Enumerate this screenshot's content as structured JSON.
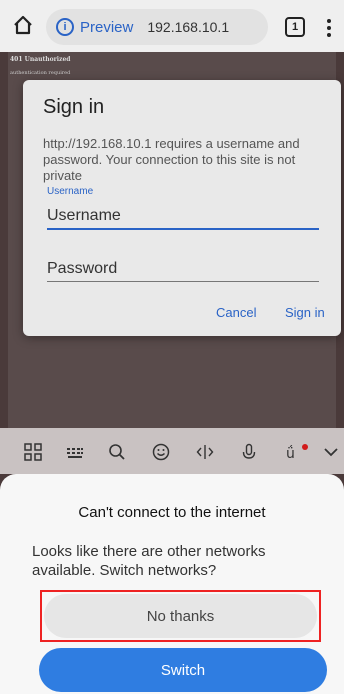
{
  "browser": {
    "preview_label": "Preview",
    "url": "192.168.10.1",
    "tab_count": "1"
  },
  "page": {
    "heading": "401 Unauthorized",
    "subtext": "authentication required"
  },
  "signin_dialog": {
    "title": "Sign in",
    "message": "http://192.168.10.1 requires a username and password. Your connection to this site is not private",
    "username_label": "Username",
    "username_placeholder": "Username",
    "password_placeholder": "Password",
    "cancel_label": "Cancel",
    "signin_label": "Sign in",
    "accent_color": "#2a63c6"
  },
  "keyboard_toolbar": {
    "icons": [
      "apps-grid-icon",
      "keyboard-icon",
      "search-icon",
      "emoji-icon",
      "cursor-move-icon",
      "microphone-icon",
      "translate-icon",
      "chevron-down-icon"
    ]
  },
  "network_sheet": {
    "title": "Can't connect to the internet",
    "message": "Looks like there are other networks available. Switch networks?",
    "no_thanks_label": "No thanks",
    "switch_label": "Switch",
    "switch_color": "#2f7de1",
    "highlight_color": "#e22222"
  }
}
